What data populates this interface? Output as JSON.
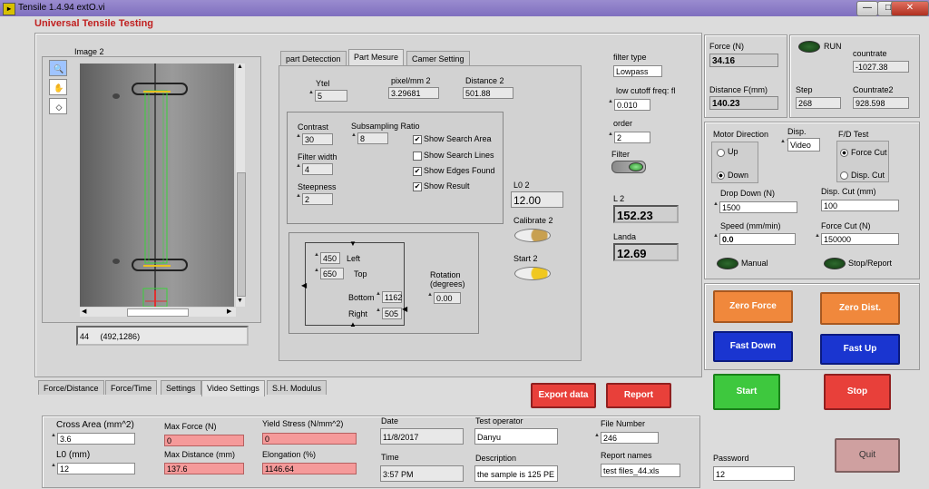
{
  "window": {
    "title": "Tensile 1.4.94 extO.vi",
    "minimize": "—",
    "maximize": "□",
    "close": "✕"
  },
  "app_title": "Universal Tensile Testing",
  "image": {
    "label": "Image 2",
    "status_left": "44",
    "status_right": "(492,1286)"
  },
  "tools": {
    "zoom": "🔍",
    "pan": "✋",
    "roi": "◇"
  },
  "scroll": {
    "up": "▲",
    "down": "▼",
    "left": "◀",
    "right": "▶"
  },
  "part_tabs": [
    "part Detecction",
    "Part Mesure",
    "Camer Setting"
  ],
  "part": {
    "ytel_label": "Ytel",
    "ytel_value": "5",
    "pixel_label": "pixel/mm 2",
    "pixel_value": "3.29681",
    "distance_label": "Distance 2",
    "distance_value": "501.88",
    "contrast_label": "Contrast",
    "contrast_value": "30",
    "subsampling_label": "Subsampling Ratio",
    "subsampling_value": "8",
    "filter_width_label": "Filter width",
    "filter_width_value": "4",
    "steepness_label": "Steepness",
    "steepness_value": "2",
    "checks": [
      {
        "label": "Show Search Area",
        "checked": "✔"
      },
      {
        "label": "Show Search Lines",
        "checked": ""
      },
      {
        "label": "Show Edges Found",
        "checked": "✔"
      },
      {
        "label": "Show Result",
        "checked": "✔"
      }
    ],
    "l02_label": "L0 2",
    "l02_value": "12.00",
    "calibrate_label": "Calibrate 2",
    "start_label": "Start  2",
    "left_value": "450",
    "left_label": "Left",
    "top_value": "650",
    "top_label": "Top",
    "bottom_label": "Bottom",
    "bottom_value": "1162",
    "right_label": "Right",
    "right_value": "505",
    "rotation_label": "Rotation\n(degrees)",
    "rotation_value": "0.00"
  },
  "filter": {
    "type_label": "filter type",
    "type_value": "Lowpass",
    "cutoff_label": "low cutoff freq: fl",
    "cutoff_value": "0.010",
    "order_label": "order",
    "order_value": "2",
    "filter_label": "Filter",
    "l2_label": "L 2",
    "l2_value": "152.23",
    "landa_label": "Landa",
    "landa_value": "12.69"
  },
  "readouts": {
    "force_label": "Force (N)",
    "force_value": "34.16",
    "distance_label": "Distance F(mm)",
    "distance_value": "140.23",
    "run_label": "RUN",
    "countrate_label": "countrate",
    "countrate_value": "-1027.38",
    "step_label": "Step",
    "step_value": "268",
    "countrate2_label": "Countrate2",
    "countrate2_value": "928.598"
  },
  "motor": {
    "direction_label": "Motor Direction",
    "up": "Up",
    "down": "Down",
    "disp_label": "Disp.",
    "disp_value": "Video",
    "fd_label": "F/D Test",
    "force_cut": "Force Cut",
    "disp_cut": "Disp. Cut",
    "drop_label": "Drop Down (N)",
    "drop_value": "1500",
    "dispcut_label": "Disp. Cut (mm)",
    "dispcut_value": "100",
    "speed_label": "Speed (mm/min)",
    "speed_value": "0.0",
    "forcecut_label": "Force Cut (N)",
    "forcecut_value": "150000",
    "manual_label": "Manual",
    "stop_report_label": "Stop/Report"
  },
  "buttons": {
    "zero_force": "Zero Force",
    "zero_dist": "Zero Dist.",
    "fast_down": "Fast Down",
    "fast_up": "Fast Up",
    "start": "Start",
    "stop": "Stop",
    "export": "Export data",
    "report": "Report",
    "quit": "Quit"
  },
  "bottom_tabs": [
    "Force/Distance",
    "Force/Time",
    "Settings",
    "Video Settings",
    "S.H. Modulus"
  ],
  "results": {
    "cross_label": "Cross Area (mm^2)",
    "cross_value": "3.6",
    "l0_label": "L0 (mm)",
    "l0_value": "12",
    "maxforce_label": "Max Force (N)",
    "maxforce_value": "0",
    "maxdist_label": "Max Distance (mm)",
    "maxdist_value": "137.6",
    "yield_label": "Yield Stress (N/mm^2)",
    "yield_value": "0",
    "elong_label": "Elongation (%)",
    "elong_value": "1146.64",
    "date_label": "Date",
    "date_value": "11/8/2017",
    "time_label": "Time",
    "time_value": "3:57 PM",
    "operator_label": "Test operator",
    "operator_value": "Danyu",
    "desc_label": "Description",
    "desc_value": "the sample is 125 PE",
    "file_label": "File Number",
    "file_value": "246",
    "report_names_label": "Report names",
    "report_names_value": "test files_44.xls"
  },
  "password": {
    "label": "Password",
    "value": "12"
  }
}
